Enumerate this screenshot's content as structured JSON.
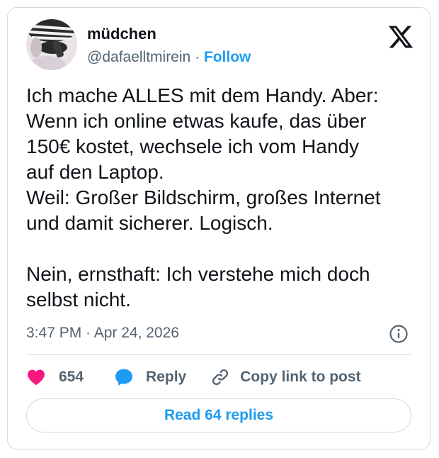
{
  "author": {
    "name": "müdchen",
    "handle": "@dafaelltmirein",
    "separator": "·",
    "follow_label": "Follow"
  },
  "tweet": {
    "text": "Ich mache ALLES mit dem Handy. Aber:\nWenn ich online etwas kaufe, das über\n150€ kostet, wechsele ich vom Handy\nauf den Laptop.\nWeil: Großer Bildschirm, großes Internet\nund damit sicherer. Logisch.\n\nNein, ernsthaft: Ich verstehe mich doch\nselbst nicht.",
    "timestamp": "3:47 PM · Apr 24, 2026"
  },
  "actions": {
    "like_count": "654",
    "reply_label": "Reply",
    "copy_link_label": "Copy link to post"
  },
  "footer": {
    "read_replies_label": "Read 64 replies"
  },
  "icons": {
    "brand": "x-logo-icon",
    "like": "heart-icon",
    "reply": "speech-bubble-icon",
    "copy": "link-icon",
    "info": "info-icon"
  },
  "colors": {
    "accent": "#1d9bf0",
    "like": "#f91880",
    "text": "#0f1419",
    "muted": "#536471",
    "border": "#cfd9de"
  }
}
